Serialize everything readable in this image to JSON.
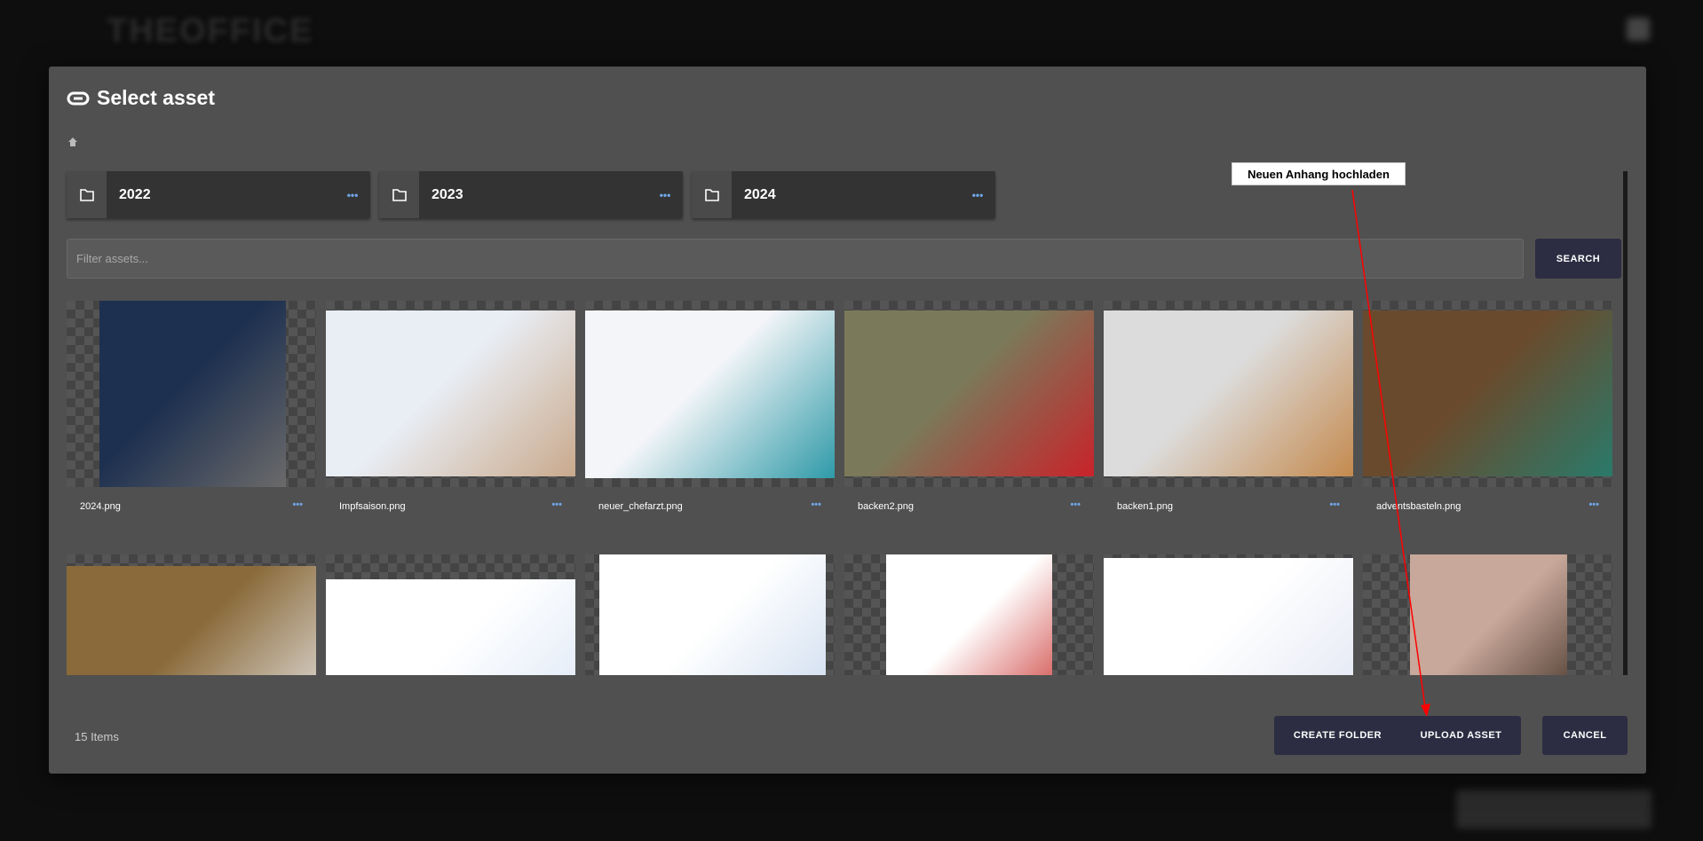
{
  "background": {
    "logo": "THEOFFICE"
  },
  "dialog": {
    "title": "Select asset",
    "title_icon": "link-icon",
    "breadcrumb_icon": "home-icon",
    "folders": [
      {
        "name": "2022",
        "menu": "•••"
      },
      {
        "name": "2023",
        "menu": "•••"
      },
      {
        "name": "2024",
        "menu": "•••"
      }
    ],
    "filter": {
      "placeholder": "Filter assets...",
      "value": ""
    },
    "search_label": "SEARCH",
    "assets": [
      {
        "name": "2024.png",
        "menu": "•••",
        "colors": [
          "#1d3050",
          "#6b6a6a"
        ]
      },
      {
        "name": "Impfsaison.png",
        "menu": "•••",
        "colors": [
          "#e9eef5",
          "#c9a98c"
        ]
      },
      {
        "name": "neuer_chefarzt.png",
        "menu": "•••",
        "colors": [
          "#f3f5f8",
          "#2f9aa8"
        ]
      },
      {
        "name": "backen2.png",
        "menu": "•••",
        "colors": [
          "#7a7a5a",
          "#c8232a"
        ]
      },
      {
        "name": "backen1.png",
        "menu": "•••",
        "colors": [
          "#dcdcdc",
          "#c48a4e"
        ]
      },
      {
        "name": "adventsbasteln.png",
        "menu": "•••",
        "colors": [
          "#6a4a2c",
          "#2a7a6a"
        ]
      },
      {
        "name": "",
        "colors": [
          "#8a6a3a",
          "#e8e8e8"
        ]
      },
      {
        "name": "",
        "colors": [
          "#ffffff",
          "#d8e4f4"
        ]
      },
      {
        "name": "",
        "colors": [
          "#ffffff",
          "#c9d9ee"
        ]
      },
      {
        "name": "",
        "colors": [
          "#ffffff",
          "#c9302c"
        ]
      },
      {
        "name": "",
        "colors": [
          "#ffffff",
          "#dfe4f2"
        ]
      },
      {
        "name": "",
        "colors": [
          "#c8a89a",
          "#3a2a20"
        ]
      }
    ],
    "item_count": "15 Items",
    "create_folder_label": "CREATE FOLDER",
    "upload_asset_label": "UPLOAD ASSET",
    "cancel_label": "CANCEL"
  },
  "annotation": {
    "text": "Neuen Anhang hochladen",
    "color": "#ff0000"
  }
}
